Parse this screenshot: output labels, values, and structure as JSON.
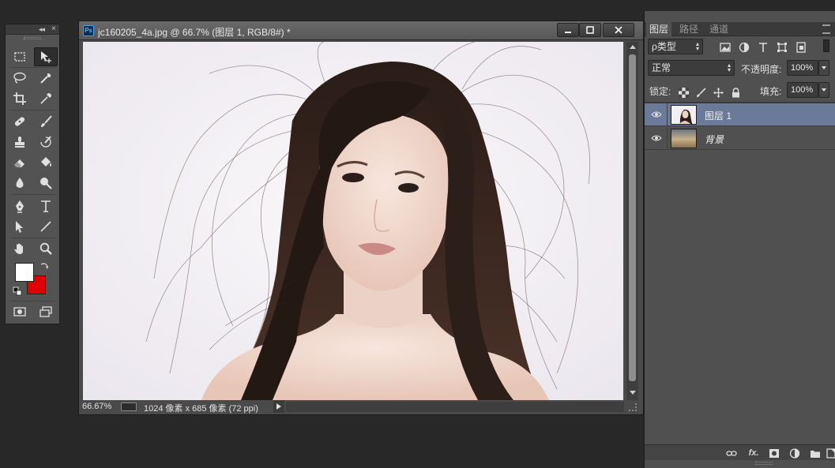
{
  "document": {
    "title": "jc160205_4a.jpg @ 66.7% (图层 1, RGB/8#) *",
    "app_badge": "Ps",
    "status": {
      "zoom": "66.67%",
      "dimensions": "1024 像素 x 685 像素 (72 ppi)"
    }
  },
  "layers_panel": {
    "tabs": [
      "图层",
      "路径",
      "通道"
    ],
    "active_tab": "图层",
    "filter_kind": "ρ类型",
    "blend_mode": "正常",
    "opacity_label": "不透明度:",
    "opacity_value": "100%",
    "lock_label": "锁定:",
    "fill_label": "填充:",
    "fill_value": "100%",
    "layers": [
      {
        "name": "图层 1",
        "selected": true,
        "visible": true
      },
      {
        "name": "背景",
        "selected": false,
        "visible": true
      }
    ],
    "footer_fx": "fx."
  },
  "toolbox": {
    "foreground_color": "#ffffff",
    "background_color": "#e00000",
    "tools": [
      "marquee-icon",
      "move-icon",
      "lasso-icon",
      "quick-select-icon",
      "crop-icon",
      "eyedropper-icon",
      "healing-brush-icon",
      "brush-icon",
      "clone-stamp-icon",
      "history-brush-icon",
      "eraser-icon",
      "paint-bucket-icon",
      "blur-icon",
      "dodge-icon",
      "pen-icon",
      "type-icon",
      "path-select-icon",
      "line-icon",
      "hand-icon",
      "zoom-icon",
      "quick-mask-icon",
      "screen-mode-icon"
    ]
  },
  "colors": {
    "selected_layer": "#6a7a98",
    "panel_bg": "#505050",
    "app_bg": "#282828"
  }
}
